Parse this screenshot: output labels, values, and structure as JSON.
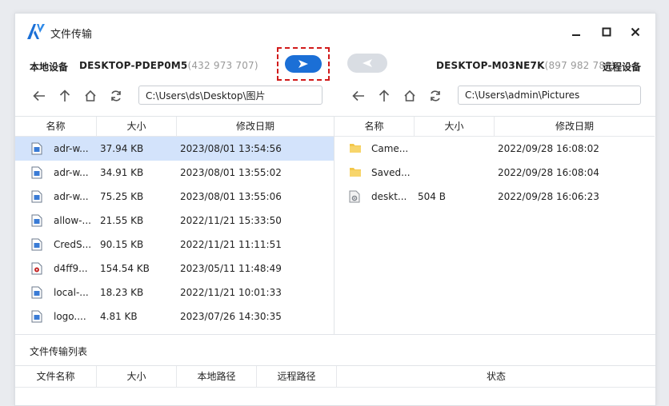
{
  "app": {
    "title": "文件传输"
  },
  "devices": {
    "local_label": "本地设备",
    "local_name": "DESKTOP-PDEP0M5",
    "local_id": "(432 973 707)",
    "remote_name": "DESKTOP-M03NE7K",
    "remote_id": "(897 982 788)",
    "remote_label": "远程设备"
  },
  "local": {
    "path": "C:\\Users\\ds\\Desktop\\图片",
    "columns": [
      "名称",
      "大小",
      "修改日期"
    ],
    "files": [
      {
        "name": "adr-w...",
        "size": "37.94 KB",
        "date": "2023/08/01 13:54:56",
        "icon": "document-icon"
      },
      {
        "name": "adr-w...",
        "size": "34.91 KB",
        "date": "2023/08/01 13:55:02",
        "icon": "document-icon"
      },
      {
        "name": "adr-w...",
        "size": "75.25 KB",
        "date": "2023/08/01 13:55:06",
        "icon": "document-icon"
      },
      {
        "name": "allow-...",
        "size": "21.55 KB",
        "date": "2022/11/21 15:33:50",
        "icon": "document-icon"
      },
      {
        "name": "CredS...",
        "size": "90.15 KB",
        "date": "2022/11/21 11:11:51",
        "icon": "document-icon"
      },
      {
        "name": "d4ff9...",
        "size": "154.54 KB",
        "date": "2023/05/11 11:48:49",
        "icon": "media-file-icon"
      },
      {
        "name": "local-...",
        "size": "18.23 KB",
        "date": "2022/11/21 10:01:33",
        "icon": "document-icon"
      },
      {
        "name": "logo....",
        "size": "4.81 KB",
        "date": "2023/07/26 14:30:35",
        "icon": "document-icon"
      }
    ]
  },
  "remote": {
    "path": "C:\\Users\\admin\\Pictures",
    "columns": [
      "名称",
      "大小",
      "修改日期"
    ],
    "files": [
      {
        "name": "Came...",
        "size": "",
        "date": "2022/09/28 16:08:02",
        "icon": "folder-icon"
      },
      {
        "name": "Saved...",
        "size": "",
        "date": "2022/09/28 16:08:04",
        "icon": "folder-icon"
      },
      {
        "name": "deskt...",
        "size": "504 B",
        "date": "2022/09/28 16:06:23",
        "icon": "settings-file-icon"
      }
    ]
  },
  "queue": {
    "title": "文件传输列表",
    "columns": [
      "文件名称",
      "大小",
      "本地路径",
      "远程路径",
      "状态"
    ]
  },
  "colors": {
    "accent": "#1b6fd6",
    "selected_row": "#d3e3fb",
    "highlight_border": "#d11a1a",
    "folder": "#f3c74a"
  }
}
